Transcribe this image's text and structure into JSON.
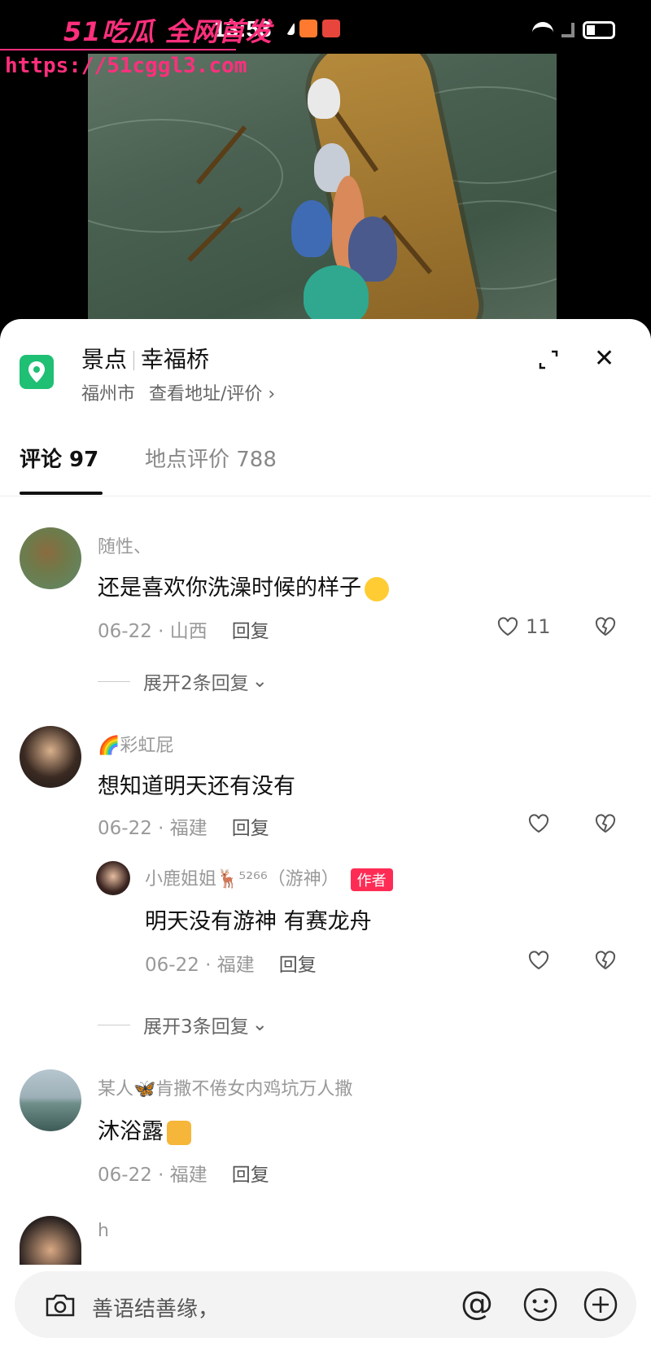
{
  "status_bar": {
    "time": "13:53"
  },
  "watermark": {
    "brand": "51吃瓜 全网首发",
    "url": "https://51cggl3.com"
  },
  "location": {
    "category": "景点",
    "name": "幸福桥",
    "city": "福州市",
    "link": "查看地址/评价 ›"
  },
  "tabs": [
    {
      "label": "评论 97",
      "active": true
    },
    {
      "label": "地点评价 788",
      "active": false
    }
  ],
  "comments": [
    {
      "username": "随性、",
      "text": "还是喜欢你洗澡时候的样子",
      "date_region": "06-22 · 山西",
      "reply_label": "回复",
      "like_count": "11",
      "expand_label": "展开2条回复"
    },
    {
      "username": "🌈彩虹屁",
      "text": "想知道明天还有没有",
      "date_region": "06-22 · 福建",
      "reply_label": "回复",
      "reply": {
        "username": "小鹿姐姐🦌⁵²⁶⁶（游神）",
        "badge": "作者",
        "text": "明天没有游神 有赛龙舟",
        "date_region": "06-22 · 福建",
        "reply_label": "回复"
      },
      "expand_label": "展开3条回复"
    },
    {
      "username": "某人🦋肯撒不倦女内鸡坑万人撒",
      "text": "沐浴露",
      "date_region": "06-22 · 福建",
      "reply_label": "回复"
    },
    {
      "username": "h"
    }
  ],
  "input_bar": {
    "placeholder": "善语结善缘，"
  },
  "colors": {
    "accent": "#fe2c55",
    "location_green": "#1fbf74",
    "watermark_pink": "#ff2f7d"
  }
}
